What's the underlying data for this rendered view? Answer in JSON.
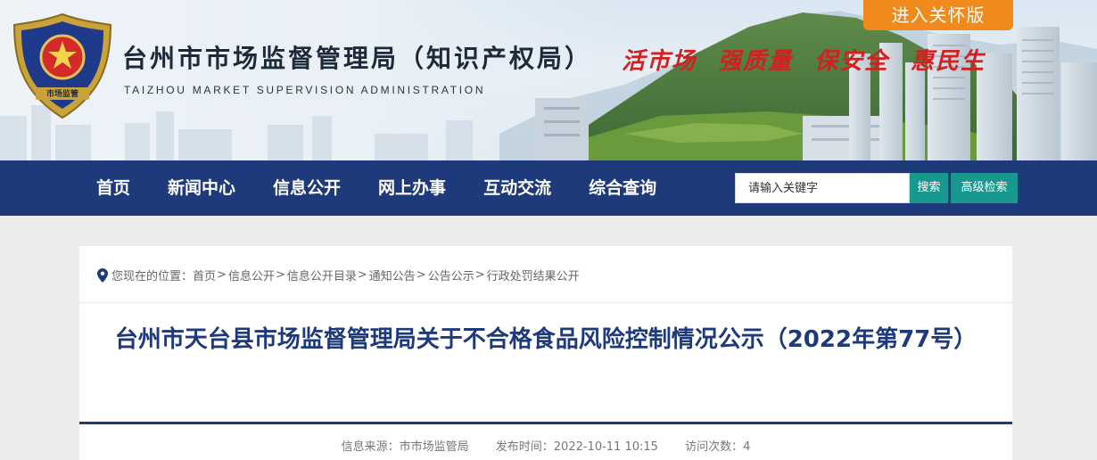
{
  "header": {
    "site_name": "台州市市场监督管理局（知识产权局）",
    "site_name_en": "TAIZHOU MARKET SUPERVISION ADMINISTRATION",
    "emblem_text": "市场监管",
    "slogans": [
      "活市场",
      "强质量",
      "保安全",
      "惠民生"
    ],
    "care_mode_label": "进入关怀版"
  },
  "nav": {
    "items": [
      "首页",
      "新闻中心",
      "信息公开",
      "网上办事",
      "互动交流",
      "综合查询"
    ],
    "search_placeholder": "请输入关键字",
    "search_label": "搜索",
    "advanced_search_label": "高级检索"
  },
  "breadcrumb": {
    "prefix": "您现在的位置：",
    "items": [
      "首页",
      "信息公开",
      "信息公开目录",
      "通知公告",
      "公告公示",
      "行政处罚结果公开"
    ],
    "separator": ">"
  },
  "article": {
    "title": "台州市天台县市场监督管理局关于不合格食品风险控制情况公示（2022年第77号）",
    "source": "信息来源：市市场监管局",
    "publish_time": "发布时间：2022-10-11 10:15",
    "views": "访问次数：4"
  },
  "colors": {
    "nav_bg": "#1f3a7a",
    "care_button": "#f08a1c",
    "search_button": "#17998f",
    "slogan": "#d21f1f",
    "title": "#1f3a7a"
  }
}
